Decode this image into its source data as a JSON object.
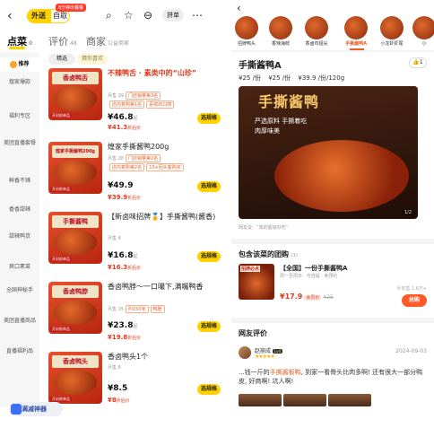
{
  "left": {
    "topbar": {
      "back_icon": "back-arrow-icon",
      "takeout_label": "外送",
      "pickup_label": "自取",
      "promo_tag": "8分钟出餐餐",
      "search_icon": "search-icon",
      "favorite_icon": "star-icon",
      "share_icon": "share-icon",
      "group_buy_label": "拼单",
      "more_icon": "more-icon"
    },
    "tabs": [
      {
        "label": "点菜",
        "count": "0"
      },
      {
        "label": "评价",
        "count": "48"
      },
      {
        "label": "商家",
        "count": "公益商家"
      }
    ],
    "sidebar": [
      {
        "label": "推荐",
        "active": true
      },
      {
        "label": "煌家爆款"
      },
      {
        "label": "福利专区"
      },
      {
        "label": "美团直播套餐"
      },
      {
        "label": "鲜香不辣"
      },
      {
        "label": "香香甜辣"
      },
      {
        "label": "甜辣鸭货"
      },
      {
        "label": "爽口素菜"
      },
      {
        "label": "全国神秘手"
      },
      {
        "label": "美团直播商品"
      },
      {
        "label": "直播福利品"
      }
    ],
    "filters": {
      "selected": "精选",
      "monthly": "猜你喜欢"
    },
    "products": [
      {
        "thumb_title": "香卤鸭舌",
        "thumb_badge": "开封前单品",
        "name": "不辣鸭舌 · 素类中的“山珍”",
        "promo": true,
        "sales": "月售 39",
        "tag1": "门店销量第3名",
        "tag2": "店内复购第1名",
        "tag3": "喜欢的口感",
        "price": "¥46.8",
        "price_suffix": "起",
        "sub_price": "¥41.3",
        "sub_suffix": "折后价",
        "spec_label": "选规格"
      },
      {
        "thumb_title": "煌家手撕酱鸭200g",
        "thumb_badge": "开封前单品",
        "name": "煌家手撕酱鸭200g",
        "promo": false,
        "sales": "月售 28",
        "tag1": "门店销量第2名",
        "tag2": "店内复购第2名",
        "tag3": "10+回头客购买",
        "price": "¥49.9",
        "price_suffix": "",
        "sub_price": "¥39.9",
        "sub_suffix": "折后价",
        "spec_label": "选规格"
      },
      {
        "thumb_title": "手撕酱鸭",
        "thumb_badge": "开封前单品",
        "name": "【新卤味招牌🏅】手撕酱鸭(酱香)",
        "promo": false,
        "sales": "月售 4",
        "tag1": "",
        "tag2": "",
        "tag3": "",
        "price": "¥16.8",
        "price_suffix": "起",
        "sub_price": "¥16.3",
        "sub_suffix": "折后价",
        "spec_label": "选规格"
      },
      {
        "thumb_title": "香卤鸭脖",
        "thumb_badge": "开封前单品",
        "name": "香卤鸭脖～一口嘬下,满嘴鸭香",
        "promo": false,
        "sales": "月售 15",
        "tag1": "约150克",
        "tag2": "鸭脖",
        "tag3": "",
        "price": "¥23.8",
        "price_suffix": "起",
        "sub_price": "¥19.8",
        "sub_suffix": "折后价",
        "spec_label": "选规格"
      },
      {
        "thumb_title": "香卤鸭头",
        "thumb_badge": "开封前单品",
        "name": "香卤鸭头1个",
        "promo": false,
        "sales": "月售 8",
        "tag1": "",
        "tag2": "",
        "tag3": "",
        "price": "¥8.5",
        "price_suffix": "",
        "sub_price": "¥8",
        "sub_suffix": "折后价",
        "spec_label": "选规格"
      }
    ],
    "floater_label": "满减神器"
  },
  "right": {
    "back_icon": "back-arrow-icon",
    "categories": [
      {
        "label": "招牌鸭头"
      },
      {
        "label": "香辣海鲜"
      },
      {
        "label": "香卤鸡翅尖"
      },
      {
        "label": "手撕酱鸭A",
        "active": true
      },
      {
        "label": "小龙虾虾尾"
      },
      {
        "label": "小"
      }
    ],
    "title": "手撕酱鸭A",
    "like_count": "1",
    "prices": [
      "¥25 /份",
      "¥25 /份",
      "¥39.9 /份/120g"
    ],
    "hero": {
      "title": "手撕酱鸭",
      "sub": "严选原料 手撕着吃 肉厚味美",
      "pager": "1/2"
    },
    "caption": "网友说：“真的超级好吃”",
    "combo_section": {
      "title": "包含该菜的团购",
      "count": "(1)",
      "thumb_label": "招牌必点",
      "name": "【全国】一份手撕酱鸭A",
      "meta": "周一至周日 · 可自提 · 免预约",
      "price": "¥17.9",
      "member": "会员价",
      "old_price": "¥25",
      "sales": "半年售 1.6万+",
      "buy_label": "抢购"
    },
    "reviews": {
      "title": "网友评价",
      "name": "赵崩成",
      "level": "Lv4",
      "stars": "★★★★★",
      "date": "2024-09-03",
      "text_prefix": "...钱一斤的",
      "text_highlight": "手撕酱板鸭",
      "text_suffix": ", 到家一看骨头比肉多啊! 还有很大一部分鸭皮, 好商啊! 坑人啊!"
    }
  }
}
